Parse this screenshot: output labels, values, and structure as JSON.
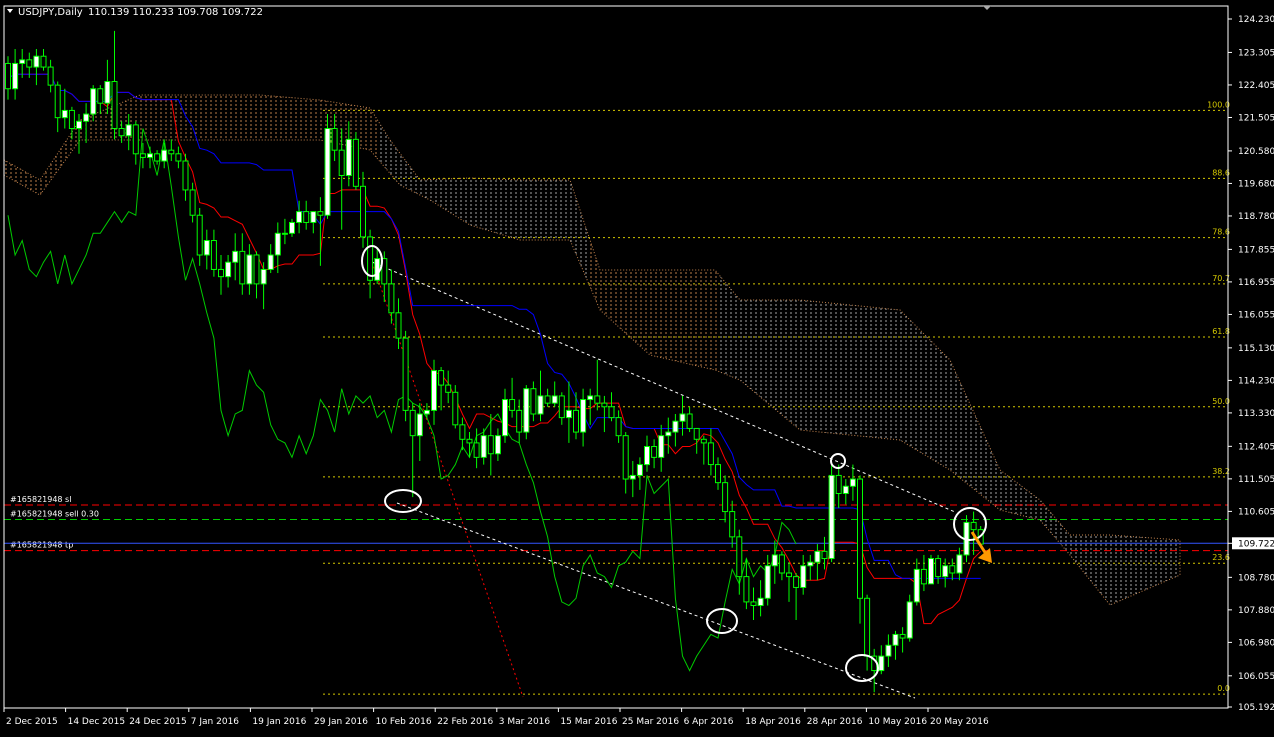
{
  "header": {
    "symbol": "USDJPY,Daily",
    "ohlc": "110.139 110.233 109.708 109.722"
  },
  "colors": {
    "background": "#000000",
    "frame": "#ffffff",
    "bull_candle": "#ffffff",
    "bull_outline": "#00ff00",
    "bear_candle": "#000000",
    "wick": "#00ff00",
    "tenkan": "#ff0000",
    "kijun": "#0000ff",
    "chikou": "#00cc00",
    "cloud": "#f4a460",
    "cloud_bear": "#ffffff",
    "fib": "#d4c800",
    "order_line": "#ff0000",
    "entry_line": "#00cc00",
    "tp_line": "#3355ff",
    "trendline": "#ffffff",
    "price_label_bg": "#ffffff",
    "arrow": "#ff9900"
  },
  "chart_data": {
    "type": "candlestick",
    "title": "USDJPY,Daily",
    "ylim": [
      105.192,
      124.23
    ],
    "price_axis_labels": [
      "124.230",
      "123.305",
      "122.405",
      "121.505",
      "120.580",
      "119.680",
      "118.780",
      "117.855",
      "116.955",
      "116.055",
      "115.130",
      "114.230",
      "113.330",
      "112.405",
      "111.505",
      "110.605",
      "109.722",
      "108.780",
      "107.880",
      "106.980",
      "106.055",
      "105.192"
    ],
    "current_price": "109.722",
    "date_labels": [
      "2 Dec 2015",
      "14 Dec 2015",
      "24 Dec 2015",
      "7 Jan 2016",
      "19 Jan 2016",
      "29 Jan 2016",
      "10 Feb 2016",
      "22 Feb 2016",
      "3 Mar 2016",
      "15 Mar 2016",
      "25 Mar 2016",
      "6 Apr 2016",
      "18 Apr 2016",
      "28 Apr 2016",
      "10 May 2016",
      "20 May 2016"
    ],
    "fib_levels": [
      {
        "label": "100.0",
        "price": 121.7
      },
      {
        "label": "88.6",
        "price": 119.82
      },
      {
        "label": "78.6",
        "price": 118.18
      },
      {
        "label": "70.7",
        "price": 116.9
      },
      {
        "label": "61.8",
        "price": 115.43
      },
      {
        "label": "50.0",
        "price": 113.5
      },
      {
        "label": "38.2",
        "price": 111.56
      },
      {
        "label": "23.6",
        "price": 109.17
      },
      {
        "label": "0.0",
        "price": 105.55
      }
    ],
    "order_lines": [
      {
        "label": "#165821948 sl",
        "price": 110.78,
        "kind": "sl"
      },
      {
        "label": "#165821948 sell 0.30",
        "price": 110.38,
        "kind": "entry"
      },
      {
        "label": "#165821948 tp",
        "price": 109.52,
        "kind": "tp"
      }
    ],
    "current_price_line": 109.722,
    "candles": [
      [
        123.0,
        123.2,
        122.0,
        122.3
      ],
      [
        122.3,
        123.4,
        122.0,
        123.0
      ],
      [
        123.0,
        123.4,
        122.6,
        123.1
      ],
      [
        123.1,
        123.3,
        122.6,
        122.9
      ],
      [
        122.9,
        123.4,
        122.4,
        123.2
      ],
      [
        123.2,
        123.4,
        122.8,
        122.9
      ],
      [
        122.9,
        123.1,
        122.2,
        122.4
      ],
      [
        122.4,
        122.5,
        121.1,
        121.5
      ],
      [
        121.5,
        122.3,
        121.2,
        121.7
      ],
      [
        121.7,
        121.8,
        120.9,
        121.2
      ],
      [
        121.2,
        121.6,
        120.5,
        121.4
      ],
      [
        121.4,
        121.9,
        120.8,
        121.6
      ],
      [
        121.6,
        122.4,
        121.4,
        122.3
      ],
      [
        122.3,
        122.4,
        121.6,
        121.9
      ],
      [
        121.9,
        123.1,
        121.6,
        122.5
      ],
      [
        122.5,
        123.9,
        120.9,
        121.2
      ],
      [
        121.2,
        121.4,
        120.8,
        121.0
      ],
      [
        121.0,
        121.6,
        120.6,
        121.3
      ],
      [
        121.3,
        121.4,
        120.2,
        120.5
      ],
      [
        120.5,
        120.8,
        120.1,
        120.4
      ],
      [
        120.4,
        120.7,
        120.1,
        120.5
      ],
      [
        120.5,
        120.6,
        120.2,
        120.3
      ],
      [
        120.3,
        120.8,
        120.1,
        120.6
      ],
      [
        120.6,
        120.9,
        120.3,
        120.5
      ],
      [
        120.5,
        120.7,
        120.1,
        120.3
      ],
      [
        120.3,
        120.5,
        119.2,
        119.5
      ],
      [
        119.5,
        119.7,
        118.6,
        118.8
      ],
      [
        118.8,
        119.0,
        117.4,
        117.7
      ],
      [
        117.7,
        118.4,
        117.3,
        118.1
      ],
      [
        118.1,
        118.4,
        117.1,
        117.3
      ],
      [
        117.3,
        117.7,
        116.6,
        117.1
      ],
      [
        117.1,
        117.7,
        116.8,
        117.5
      ],
      [
        117.5,
        118.3,
        117.0,
        117.8
      ],
      [
        117.8,
        118.3,
        116.6,
        116.9
      ],
      [
        116.9,
        118.0,
        116.6,
        117.7
      ],
      [
        117.7,
        117.8,
        116.5,
        116.9
      ],
      [
        116.9,
        117.5,
        116.2,
        117.3
      ],
      [
        117.3,
        118.0,
        117.2,
        117.7
      ],
      [
        117.7,
        118.6,
        117.2,
        118.3
      ],
      [
        118.3,
        118.7,
        118.0,
        118.3
      ],
      [
        118.3,
        118.7,
        118.2,
        118.6
      ],
      [
        118.6,
        119.2,
        118.3,
        118.9
      ],
      [
        118.9,
        119.2,
        118.4,
        118.6
      ],
      [
        118.6,
        118.9,
        118.3,
        118.9
      ],
      [
        118.9,
        119.3,
        117.4,
        118.8
      ],
      [
        118.8,
        121.6,
        118.7,
        121.2
      ],
      [
        121.2,
        121.6,
        120.3,
        120.6
      ],
      [
        120.6,
        121.2,
        118.4,
        119.9
      ],
      [
        119.9,
        121.4,
        119.6,
        120.9
      ],
      [
        120.9,
        121.1,
        119.5,
        119.6
      ],
      [
        119.6,
        120.0,
        117.9,
        118.2
      ],
      [
        118.2,
        118.4,
        116.5,
        117.0
      ],
      [
        117.0,
        117.9,
        116.9,
        117.6
      ],
      [
        117.6,
        117.8,
        116.4,
        116.9
      ],
      [
        116.9,
        117.3,
        115.8,
        116.1
      ],
      [
        116.1,
        116.5,
        115.1,
        115.4
      ],
      [
        115.4,
        115.6,
        113.1,
        113.4
      ],
      [
        113.4,
        113.6,
        111.0,
        112.7
      ],
      [
        112.7,
        113.6,
        112.0,
        113.3
      ],
      [
        113.3,
        113.6,
        113.2,
        113.4
      ],
      [
        113.4,
        114.8,
        113.0,
        114.5
      ],
      [
        114.5,
        114.6,
        113.4,
        114.1
      ],
      [
        114.1,
        114.5,
        113.6,
        113.9
      ],
      [
        113.9,
        114.1,
        112.9,
        113.0
      ],
      [
        113.0,
        113.2,
        112.3,
        112.6
      ],
      [
        112.6,
        112.8,
        112.1,
        112.5
      ],
      [
        112.5,
        112.9,
        111.8,
        112.1
      ],
      [
        112.1,
        112.9,
        111.9,
        112.7
      ],
      [
        112.7,
        113.3,
        111.6,
        112.2
      ],
      [
        112.2,
        112.9,
        112.0,
        112.7
      ],
      [
        112.7,
        114.0,
        112.5,
        113.7
      ],
      [
        113.7,
        114.3,
        113.2,
        113.4
      ],
      [
        113.4,
        113.7,
        112.5,
        112.8
      ],
      [
        112.8,
        114.1,
        112.6,
        114.0
      ],
      [
        114.0,
        114.2,
        113.1,
        113.3
      ],
      [
        113.3,
        114.5,
        113.1,
        113.8
      ],
      [
        113.8,
        114.0,
        113.5,
        113.6
      ],
      [
        113.6,
        114.2,
        113.5,
        113.8
      ],
      [
        113.8,
        113.9,
        113.0,
        113.2
      ],
      [
        113.2,
        114.2,
        112.5,
        113.4
      ],
      [
        113.4,
        113.9,
        112.6,
        112.8
      ],
      [
        112.8,
        114.0,
        112.4,
        113.7
      ],
      [
        113.7,
        114.0,
        113.0,
        113.8
      ],
      [
        113.8,
        114.8,
        113.4,
        113.6
      ],
      [
        113.6,
        113.8,
        112.8,
        113.5
      ],
      [
        113.5,
        113.9,
        113.1,
        113.2
      ],
      [
        113.2,
        113.4,
        112.5,
        112.7
      ],
      [
        112.7,
        112.8,
        111.1,
        111.5
      ],
      [
        111.5,
        112.0,
        111.0,
        111.6
      ],
      [
        111.6,
        112.1,
        111.2,
        111.9
      ],
      [
        111.9,
        112.7,
        111.7,
        112.4
      ],
      [
        112.4,
        112.6,
        111.8,
        112.1
      ],
      [
        112.1,
        113.0,
        111.7,
        112.7
      ],
      [
        112.7,
        113.2,
        112.2,
        112.8
      ],
      [
        112.8,
        113.3,
        112.4,
        113.1
      ],
      [
        113.1,
        113.8,
        112.7,
        113.3
      ],
      [
        113.3,
        113.5,
        112.8,
        112.9
      ],
      [
        112.9,
        112.9,
        112.2,
        112.6
      ],
      [
        112.6,
        112.7,
        111.9,
        112.5
      ],
      [
        112.5,
        112.9,
        111.6,
        111.9
      ],
      [
        111.9,
        112.1,
        111.2,
        111.4
      ],
      [
        111.4,
        111.6,
        110.3,
        110.6
      ],
      [
        110.6,
        110.9,
        109.6,
        109.9
      ],
      [
        109.9,
        110.1,
        108.3,
        108.8
      ],
      [
        108.8,
        109.3,
        107.9,
        108.1
      ],
      [
        108.1,
        108.5,
        107.6,
        108.0
      ],
      [
        108.0,
        108.7,
        107.7,
        108.2
      ],
      [
        108.2,
        109.4,
        108.0,
        109.1
      ],
      [
        109.1,
        109.8,
        108.6,
        109.4
      ],
      [
        109.4,
        109.5,
        108.7,
        108.9
      ],
      [
        108.9,
        109.2,
        108.1,
        108.8
      ],
      [
        108.8,
        108.9,
        107.6,
        108.5
      ],
      [
        108.5,
        109.4,
        108.3,
        109.1
      ],
      [
        109.1,
        109.4,
        108.7,
        109.2
      ],
      [
        109.2,
        109.7,
        108.7,
        109.5
      ],
      [
        109.5,
        109.9,
        109.0,
        109.3
      ],
      [
        109.3,
        111.9,
        109.2,
        111.6
      ],
      [
        111.6,
        111.9,
        110.7,
        111.1
      ],
      [
        111.1,
        111.5,
        110.8,
        111.3
      ],
      [
        111.3,
        111.9,
        110.9,
        111.5
      ],
      [
        111.5,
        111.6,
        107.5,
        108.2
      ],
      [
        108.2,
        108.3,
        106.2,
        106.6
      ],
      [
        106.6,
        106.8,
        105.6,
        106.2
      ],
      [
        106.2,
        106.9,
        106.1,
        106.6
      ],
      [
        106.6,
        107.2,
        106.3,
        106.9
      ],
      [
        106.9,
        107.3,
        106.5,
        107.2
      ],
      [
        107.2,
        107.4,
        106.7,
        107.1
      ],
      [
        107.1,
        108.3,
        107.0,
        108.1
      ],
      [
        108.1,
        109.3,
        108.0,
        109.0
      ],
      [
        109.0,
        109.4,
        108.4,
        108.6
      ],
      [
        108.6,
        109.4,
        108.6,
        109.3
      ],
      [
        109.3,
        109.4,
        108.6,
        108.8
      ],
      [
        108.8,
        109.3,
        108.5,
        109.1
      ],
      [
        109.1,
        109.3,
        108.7,
        108.9
      ],
      [
        108.9,
        109.6,
        108.7,
        109.4
      ],
      [
        109.4,
        110.5,
        109.2,
        110.3
      ],
      [
        110.3,
        110.6,
        109.4,
        110.1
      ],
      [
        110.1,
        110.2,
        109.7,
        109.7
      ]
    ],
    "annotations": [
      "circle markers on swing points",
      "descending trendlines",
      "sell arrow"
    ]
  }
}
